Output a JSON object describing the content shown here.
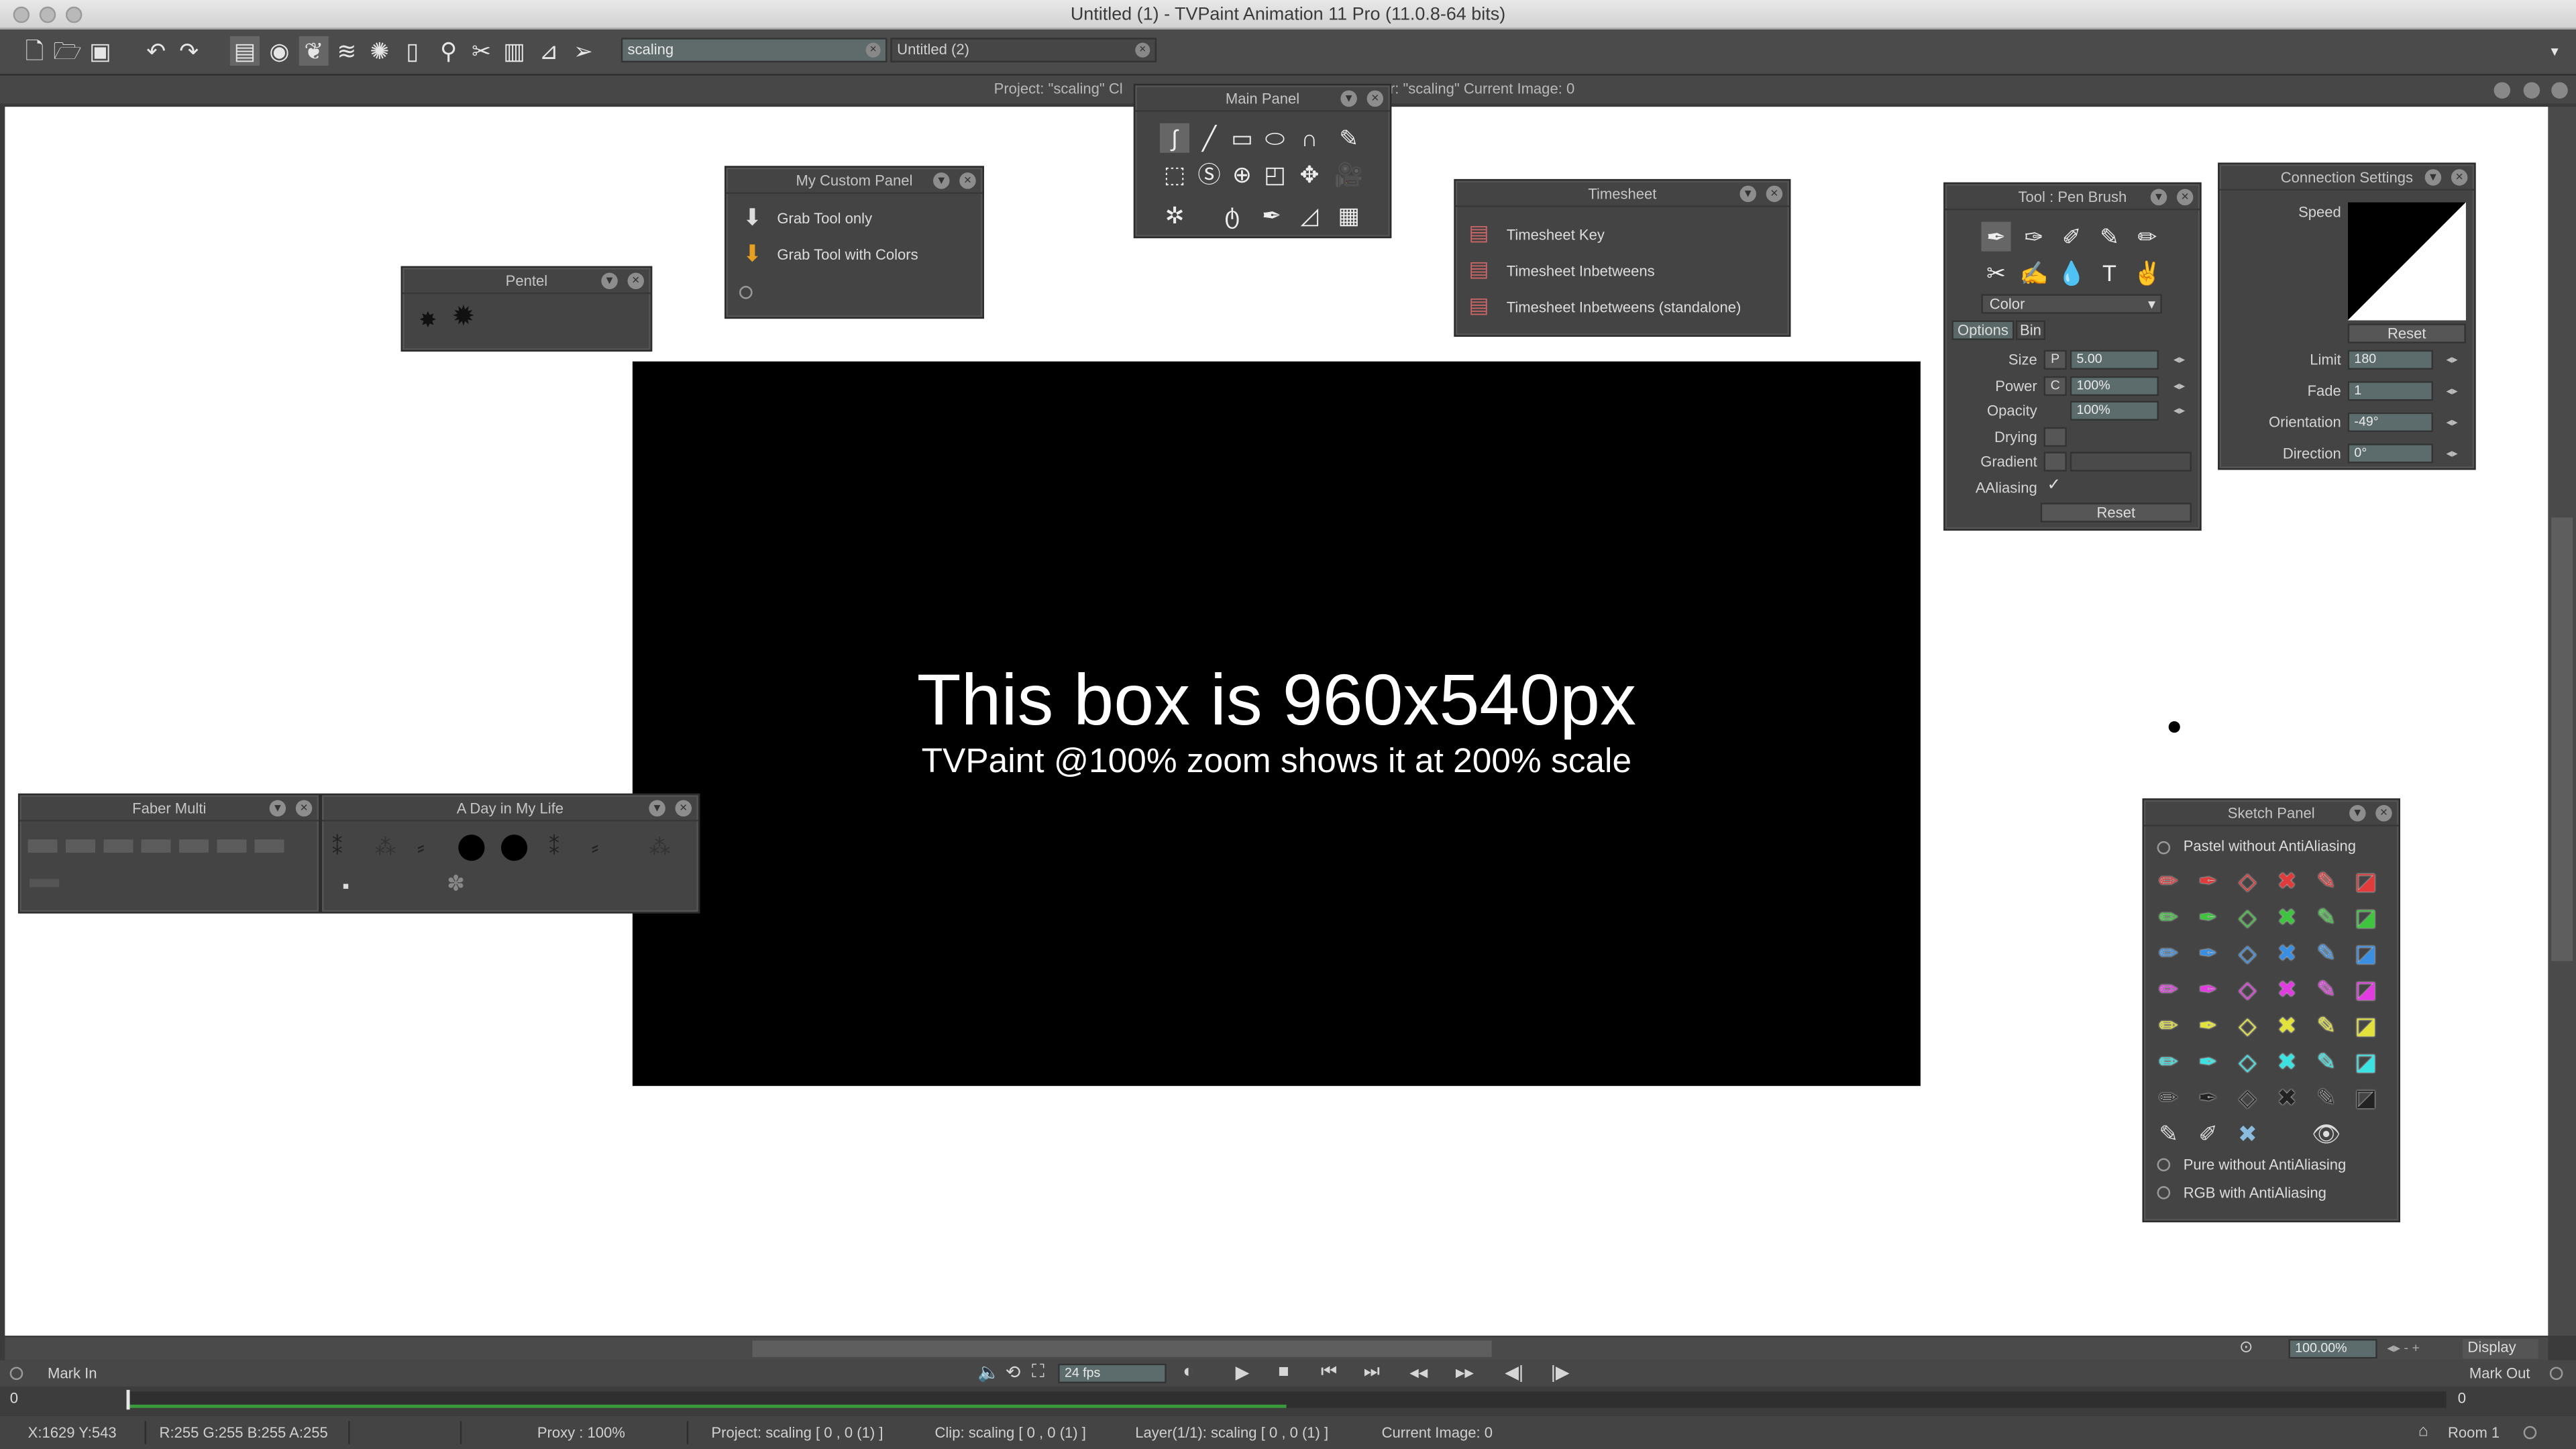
{
  "window": {
    "title": "Untitled (1) - TVPaint Animation 11 Pro (11.0.8-64 bits)"
  },
  "tabs": [
    {
      "label": "scaling"
    },
    {
      "label": "Untitled (2)"
    }
  ],
  "project_strip": {
    "left": "Project: \"scaling\"  Cl",
    "right": "r: \"scaling\"  Current Image: 0"
  },
  "canvas": {
    "line1": "This box  is 960x540px",
    "line2": "TVPaint @100% zoom shows it at 200% scale"
  },
  "panels": {
    "pentel": {
      "title": "Pentel"
    },
    "custom": {
      "title": "My Custom Panel",
      "items": [
        "Grab Tool only",
        "Grab Tool with Colors"
      ]
    },
    "main": {
      "title": "Main Panel"
    },
    "timesheet": {
      "title": "Timesheet",
      "items": [
        "Timesheet Key",
        "Timesheet Inbetweens",
        "Timesheet Inbetweens (standalone)"
      ]
    },
    "penbrush": {
      "title": "Tool : Pen Brush",
      "color_label": "Color",
      "tab_options": "Options",
      "tab_bin": "Bin",
      "size_label": "Size",
      "size_mode": "P",
      "size_value": "5.00",
      "power_label": "Power",
      "power_mode": "C",
      "power_value": "100%",
      "opacity_label": "Opacity",
      "opacity_value": "100%",
      "drying_label": "Drying",
      "gradient_label": "Gradient",
      "aaliasing_label": "AAliasing",
      "aaliasing_check": "✓",
      "reset": "Reset"
    },
    "connection": {
      "title": "Connection Settings",
      "speed_label": "Speed",
      "reset": "Reset",
      "limit_label": "Limit",
      "limit_value": "180",
      "fade_label": "Fade",
      "fade_value": "1",
      "orientation_label": "Orientation",
      "orientation_value": "-49°",
      "direction_label": "Direction",
      "direction_value": "0°"
    },
    "faber": {
      "title": "Faber Multi"
    },
    "dayinlife": {
      "title": "A Day in My Life"
    },
    "sketch": {
      "title": "Sketch Panel",
      "group1": "Pastel without AntiAliasing",
      "group2": "Pure without AntiAliasing",
      "group3": "RGB with AntiAliasing",
      "row_colors": [
        "#e23b3b",
        "#3ec43e",
        "#3b8fe2",
        "#e23be2",
        "#e2e23b",
        "#3be2e2",
        "#222222"
      ]
    }
  },
  "transport": {
    "mark_in": "Mark In",
    "mark_out": "Mark Out",
    "fps": "24 fps",
    "zoom": "100.00%",
    "display": "Display",
    "in_frame": "0",
    "out_frame": "0"
  },
  "status": {
    "coords": "X:1629  Y:543",
    "rgba": "R:255 G:255 B:255 A:255",
    "proxy": "Proxy : 100%",
    "project": "Project: scaling [ 0 , 0  (1) ]",
    "clip": "Clip: scaling [ 0 , 0  (1) ]",
    "layer": "Layer(1/1): scaling [ 0 , 0  (1) ]",
    "current_image": "Current Image: 0",
    "room": "Room 1"
  }
}
